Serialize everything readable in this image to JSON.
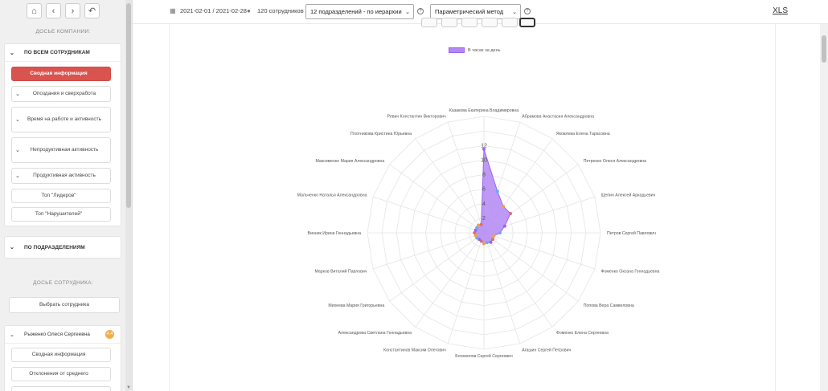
{
  "sidebar": {
    "company_title": "ДОСЬЕ КОМПАНИИ:",
    "all_employees": "ПО ВСЕМ СОТРУДНИКАМ",
    "items": [
      {
        "label": "Сводная информация",
        "active": true
      },
      {
        "label": "Опоздания и сверхработа",
        "chevron": true
      },
      {
        "label": "Время на работе и активность",
        "chevron": true
      },
      {
        "label": "Непродуктивная активность",
        "chevron": true
      },
      {
        "label": "Продуктивная активность",
        "chevron": true
      },
      {
        "label": "Топ \"Лидеров\""
      },
      {
        "label": "Топ \"Нарушителей\""
      }
    ],
    "by_departments": "ПО ПОДРАЗДЕЛЕНИЯМ",
    "employee_title": "ДОСЬЕ СОТРУДНИКА:",
    "select_employee": "Выбрать сотрудника",
    "employee_name": "Рыженко Олеся Сергеевна",
    "employee_badge": "4.4",
    "employee_items": [
      "Сводная информация",
      "Отклонения от среднего"
    ]
  },
  "topbar": {
    "date_range": "2021-02-01 / 2021-02-28",
    "employee_count": "120 сотрудников",
    "department_select": "12 подразделений - по иерархии",
    "method_select": "Параметрический метод",
    "xls": "XLS"
  },
  "chart_data": {
    "type": "radar",
    "legend": "В часах за день",
    "series_color": "#b388f5",
    "r_ticks": [
      "2",
      "4",
      "6",
      "8",
      "10",
      "12"
    ],
    "rmax": 12,
    "axes": [
      "Казакова Екатерина Владимировна",
      "Абрамова Анастасия Александровна",
      "Яковлева Елена Тарасовна",
      "Петренко Олеся Александровна",
      "Щепин Алексей Аркадьевич",
      "Петров Сергей Павлович",
      "Фоменко Оксана Геннадьевна",
      "Попова Вера Самвеловна",
      "Фоменко Елена Сергеевна",
      "Агашин Сергей Петрович",
      "Богомолов Сергей Сергеевич",
      "Константинов Максим Олегович",
      "Александрова Светлана Геннадьевна",
      "Михеева Мария Григорьевна",
      "Марков Виталий Павлович",
      "Винник Ирина Геннадьевна",
      "Мальченко Наталья Александровна",
      "Максименко Мария Александровна",
      "Плотникова Кристина Юрьевна",
      "Ревин Константин Викторович"
    ],
    "values": [
      11.5,
      6,
      4.5,
      4.5,
      3,
      2.2,
      1.4,
      1.5,
      1.6,
      1.4,
      1.5,
      1.2,
      1.1,
      1.2,
      1.2,
      1.3,
      1.2,
      1.2,
      1.3,
      1.2
    ]
  }
}
